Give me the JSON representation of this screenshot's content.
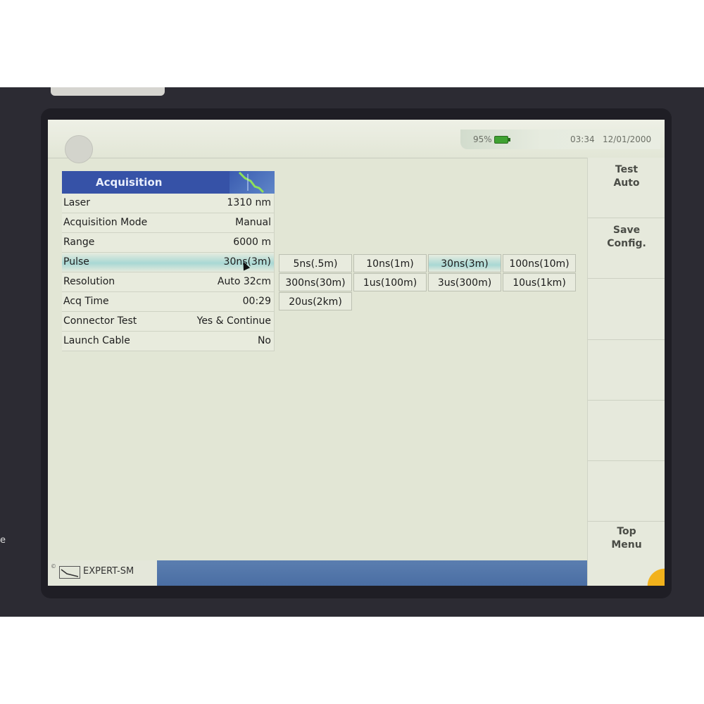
{
  "status": {
    "battery_percent": "95%",
    "time": "03:34",
    "date": "12/01/2000"
  },
  "panel": {
    "title": "Acquisition",
    "rows": [
      {
        "label": "Laser",
        "value": "1310 nm"
      },
      {
        "label": "Acquisition Mode",
        "value": "Manual"
      },
      {
        "label": "Range",
        "value": "6000 m"
      },
      {
        "label": "Pulse",
        "value": "30ns(3m)"
      },
      {
        "label": "Resolution",
        "value": "Auto 32cm"
      },
      {
        "label": "Acq Time",
        "value": "00:29"
      },
      {
        "label": "Connector Test",
        "value": "Yes & Continue"
      },
      {
        "label": "Launch Cable",
        "value": "No"
      }
    ]
  },
  "pulse_options": [
    "5ns(.5m)",
    "10ns(1m)",
    "30ns(3m)",
    "100ns(10m)",
    "300ns(30m)",
    "1us(100m)",
    "3us(300m)",
    "10us(1km)",
    "20us(2km)"
  ],
  "pulse_selected": "30ns(3m)",
  "sidebar": {
    "test_auto": "Test\nAuto",
    "save_config": "Save\nConfig.",
    "top_menu": "Top\nMenu"
  },
  "footer": {
    "app_name": "EXPERT-SM"
  },
  "colors": {
    "header_blue": "#3652a7",
    "selection_cyan": "#a9d8d4",
    "battery_green": "#3fa232"
  }
}
